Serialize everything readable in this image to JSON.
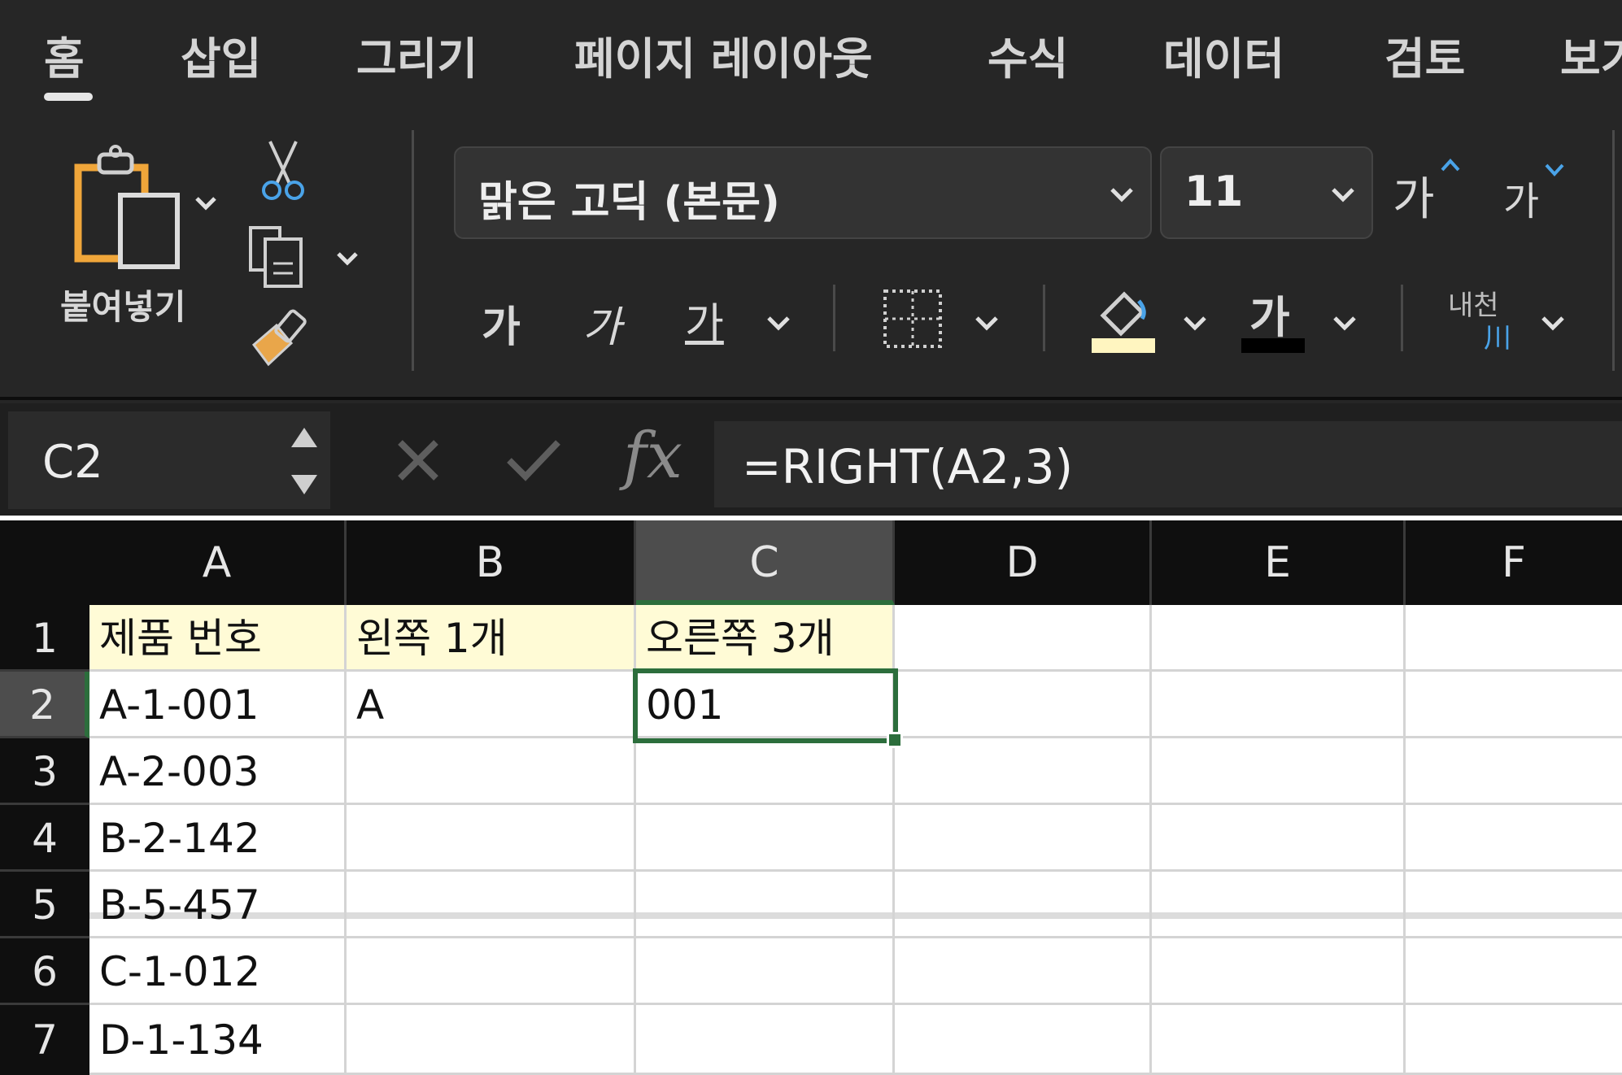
{
  "ribbon": {
    "tabs": [
      "홈",
      "삽입",
      "그리기",
      "페이지 레이아웃",
      "수식",
      "데이터",
      "검토",
      "보기"
    ],
    "active_tab": "홈",
    "clipboard": {
      "paste_label": "붙여넣기"
    },
    "font": {
      "name": "맑은 고딕 (본문)",
      "size": "11",
      "grow_label": "가",
      "shrink_label": "가",
      "bold_label": "가",
      "italic_label": "가",
      "underline_label": "가",
      "font_color_label": "가",
      "phonetic_top": "내천",
      "phonetic_bottom": "川"
    },
    "colors": {
      "fill_color": "#fff5c0",
      "font_color": "#000000",
      "accent": "#2c6e3c"
    }
  },
  "formula_bar": {
    "name_box": "C2",
    "fx_label": "fx",
    "formula": "=RIGHT(A2,3)"
  },
  "grid": {
    "columns": [
      "A",
      "B",
      "C",
      "D",
      "E",
      "F"
    ],
    "rows": [
      "1",
      "2",
      "3",
      "4",
      "5",
      "6",
      "7"
    ],
    "selected_cell": "C2",
    "cells": {
      "A1": "제품 번호",
      "B1": "왼쪽 1개",
      "C1": "오른쪽 3개",
      "A2": "A-1-001",
      "B2": "A",
      "C2": "001",
      "A3": "A-2-003",
      "A4": "B-2-142",
      "A5": "B-5-457",
      "A6": "C-1-012",
      "A7": "D-1-134"
    }
  }
}
